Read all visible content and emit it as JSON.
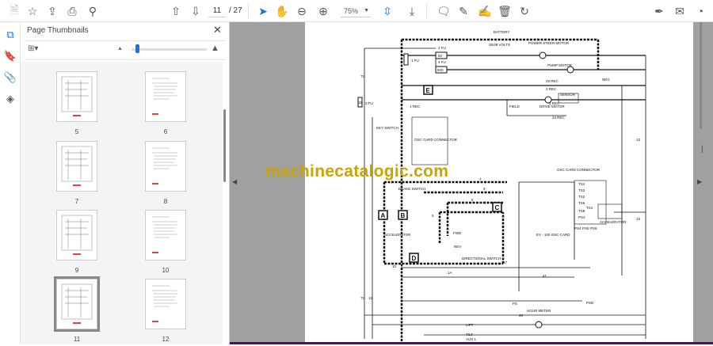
{
  "toolbar": {
    "page_current": "11",
    "page_total": "/ 27",
    "zoom": "75%"
  },
  "panel": {
    "title": "Page Thumbnails",
    "close": "✕"
  },
  "thumbnails": [
    {
      "label": "5"
    },
    {
      "label": "6"
    },
    {
      "label": "7"
    },
    {
      "label": "8"
    },
    {
      "label": "9"
    },
    {
      "label": "10"
    },
    {
      "label": "11",
      "selected": true
    },
    {
      "label": "12"
    }
  ],
  "watermark": "machinecatalogic.com",
  "diagram": {
    "battery": "BATTERY",
    "volts": "36/48 VOLTS",
    "power_steer": "POWER STEER MOTOR",
    "pump_motor": "PUMP MOTOR",
    "fu2": "2 FU",
    "fu4": "4 FU",
    "fu2_val": "50",
    "fu4_val": "500",
    "fu1": "1 FU",
    "fu3": "3 FU",
    "fu3_val": "15",
    "neg": "NEG",
    "rec25": "25 REC",
    "rec3": "3 REC",
    "rec1": "1 REC",
    "rec4": "4 REC",
    "rec24": "24 REC",
    "field": "FIELD",
    "drive_motor": "DRIVE MOTOR",
    "sensor": "SENSOR",
    "key_switch": "KEY SWITCH",
    "osc1": "OSC CARD CONNECTOR",
    "osc2": "OSC CARD CONNECTOR",
    "brake": "BRAKE SWITCH",
    "accel1": "ACCELERATOR",
    "accel2": "ACCELERATOR",
    "fwd": "FWD",
    "rev": "REV",
    "dir": "DIRECTIONAL SWITCH",
    "ev": "EV - 100 OSC CARD",
    "hour": "HOUR METER",
    "lift": "LIFT",
    "tilt": "TILT",
    "aux": "AUX 1",
    "psd": "PSD",
    "ps": "PS",
    "boxes": [
      "A",
      "B",
      "C",
      "D",
      "E"
    ],
    "pins": [
      "TS4",
      "TS3",
      "TS2",
      "TS6",
      "TS8",
      "TS1",
      "PS3",
      "PS4",
      "PS5",
      "PS6"
    ],
    "wires": [
      "71",
      "71",
      "12",
      "10",
      "13",
      "13",
      "41",
      "27",
      "26",
      "7",
      "9",
      "6",
      "1A",
      "5"
    ]
  }
}
